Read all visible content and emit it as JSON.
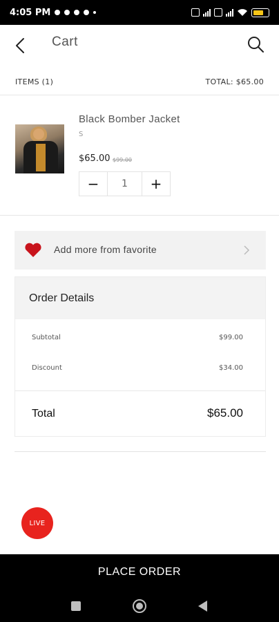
{
  "status_bar": {
    "time": "4:05 PM",
    "battery_level": "60"
  },
  "header": {
    "title": "Cart"
  },
  "summary": {
    "items_label": "ITEMS (1)",
    "total_label": "TOTAL: $65.00"
  },
  "cart_items": [
    {
      "name": "Black Bomber Jacket",
      "size": "S",
      "price": "$65.00",
      "old_price": "$99.00",
      "quantity": "1"
    }
  ],
  "stepper": {
    "minus": "−",
    "plus": "+"
  },
  "favorite_banner": {
    "label": "Add more from favorite"
  },
  "order_details": {
    "title": "Order Details",
    "subtotal_label": "Subtotal",
    "subtotal_value": "$99.00",
    "discount_label": "Discount",
    "discount_value": "$34.00",
    "total_label": "Total",
    "total_value": "$65.00"
  },
  "live_badge": {
    "label": "LIVE"
  },
  "place_order": {
    "label": "PLACE ORDER"
  },
  "colors": {
    "accent_red": "#e8231e",
    "bar_black": "#000000",
    "panel_gray": "#f2f2f2"
  },
  "icons": {
    "back": "arrow-left-icon",
    "search": "search-icon",
    "heart": "heart-icon",
    "chevron": "chevron-right-icon",
    "nav_recents": "square-icon",
    "nav_home": "circle-icon",
    "nav_back": "triangle-back-icon"
  }
}
